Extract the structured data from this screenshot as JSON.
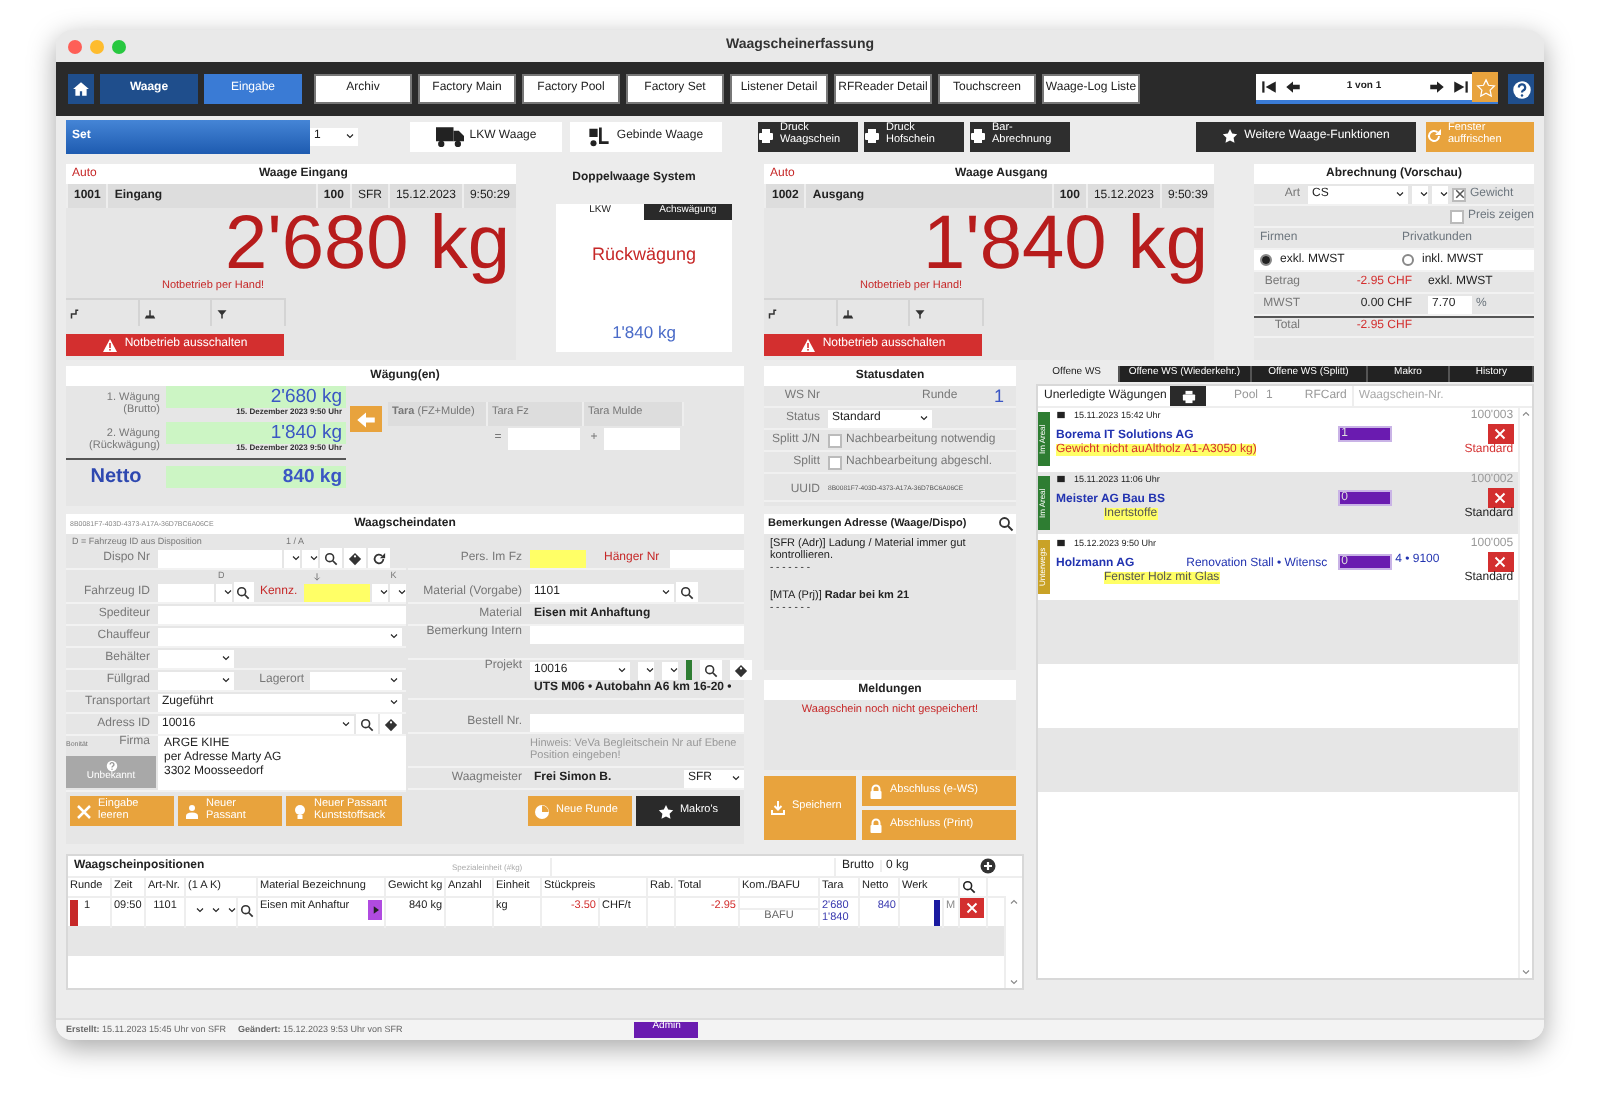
{
  "window": {
    "title": "Waagscheinerfassung"
  },
  "nav_tabs": [
    {
      "label": "Waage",
      "kind": "mode",
      "selected": true
    },
    {
      "label": "Eingabe",
      "kind": "mode",
      "selected": false
    },
    {
      "label": "Archiv",
      "kind": "tab",
      "selected": false
    },
    {
      "label": "Factory Main",
      "kind": "tab",
      "selected": false
    },
    {
      "label": "Factory Pool",
      "kind": "tab",
      "selected": false
    },
    {
      "label": "Factory Set",
      "kind": "tab",
      "selected": false
    },
    {
      "label": "Listener Detail",
      "kind": "tab",
      "selected": false
    },
    {
      "label": "RFReader Detail",
      "kind": "tab",
      "selected": false
    },
    {
      "label": "Touchscreen",
      "kind": "tab",
      "selected": false
    },
    {
      "label": "Waage-Log Liste",
      "kind": "tab",
      "selected": false
    }
  ],
  "pager": {
    "text": "1 von 1",
    "favorite": false
  },
  "toolbar": {
    "set_label": "Set",
    "set_value": "1",
    "scale_buttons": [
      {
        "label": "LKW Waage",
        "kind": "truck"
      },
      {
        "label": "Gebinde Waage",
        "kind": "forklift"
      }
    ],
    "print_buttons": [
      {
        "label": "Druck Waagschein",
        "kind": "print"
      },
      {
        "label": "Druck Hofschein",
        "kind": "print"
      },
      {
        "label": "Bar-Abrechnung",
        "kind": "print"
      }
    ],
    "function_buttons": [
      {
        "label": "Weitere Waage-Funktionen",
        "kind": "star"
      },
      {
        "label": "Fenster auffrischen",
        "kind": "refresh"
      }
    ]
  },
  "scales": [
    {
      "mode": "Auto",
      "title": "Waage Eingang",
      "number": "1001",
      "name": "Eingang",
      "code": "100",
      "user": "SFR",
      "date": "15.12.2023",
      "time": "9:50:29",
      "weight": "2'680 kg",
      "note": "Notbetrieb per Hand!",
      "action": "Notbetrieb ausschalten"
    },
    {
      "mode": "Auto",
      "title": "Waage Ausgang",
      "number": "1002",
      "name": "Ausgang",
      "code": "100",
      "date": "15.12.2023",
      "time": "9:50:39",
      "weight": "1'840 kg",
      "note": "Notbetrieb per Hand!",
      "action": "Notbetrieb ausschalten"
    }
  ],
  "double_scale": {
    "title": "Doppelwaage System",
    "tabs": [
      {
        "label": "LKW",
        "selected": true
      },
      {
        "label": "Achswägung",
        "selected": false
      }
    ],
    "status": "Rückwägung",
    "weight": "1'840 kg"
  },
  "billing": {
    "title": "Abrechnung (Vorschau)",
    "type_label": "Art",
    "type": "CS",
    "options": [
      {
        "label": "Gewicht",
        "checked": true
      },
      {
        "label": "Preis zeigen",
        "checked": false
      }
    ],
    "customer_tabs": [
      "Firmen",
      "Privatkunden"
    ],
    "vat": [
      {
        "label": "exkl. MWST",
        "selected": true
      },
      {
        "label": "inkl. MWST",
        "selected": false
      }
    ],
    "rows": [
      {
        "label": "Betrag",
        "value": "-2.95 CHF",
        "negative": true,
        "extra": "exkl. MWST"
      },
      {
        "label": "MWST",
        "value": "0.00 CHF",
        "negative": false,
        "rate": "7.70",
        "unit": "%"
      },
      {
        "label": "Total",
        "value": "-2.95 CHF",
        "negative": true
      }
    ]
  },
  "weighings": {
    "title": "Wägung(en)",
    "rows": [
      {
        "label": "1. Wägung",
        "sub": "(Brutto)",
        "value": "2'680 kg",
        "date": "15. Dezember 2023 9:50 Uhr"
      },
      {
        "label": "2. Wägung",
        "sub": "(Rückwägung)",
        "value": "1'840 kg",
        "date": "15. Dezember 2023 9:50 Uhr"
      }
    ],
    "net": {
      "label": "Netto",
      "value": "840 kg"
    },
    "tara_headers": [
      "**Tara** (FZ+Mulde)",
      "Tara Fz",
      "Tara Mulde"
    ],
    "operators": [
      "=",
      "+"
    ]
  },
  "status": {
    "title": "Statusdaten",
    "ws_label": "WS Nr",
    "round_label": "Runde",
    "round": "1",
    "status_label": "Status",
    "status": "Standard",
    "checks": [
      {
        "label": "Splitt J/N",
        "text": "Nachbearbeitung notwendig",
        "checked": false
      },
      {
        "label": "Splitt",
        "text": "Nachbearbeitung abgeschl.",
        "checked": false
      }
    ],
    "uuid_label": "UUID",
    "uuid": "8B0081F7-403D-4373-A17A-36D7BC6A06CE"
  },
  "ticket": {
    "uuid": "8B0081F7-403D-4373-A17A-36D7BC6A06CE",
    "title": "Waagscheindaten",
    "hint": "D = Fahrzeug ID aus Disposition",
    "marks": [
      "1 / A",
      "D",
      "K"
    ],
    "left_rows": [
      {
        "kind": "dispo",
        "label": "Dispo Nr"
      },
      {
        "kind": "vehicle",
        "label": "Fahrzeug ID",
        "label2": "Kennz."
      },
      {
        "kind": "text",
        "label": "Spediteur"
      },
      {
        "kind": "select",
        "label": "Chauffeur"
      },
      {
        "kind": "short",
        "label": "Behälter"
      },
      {
        "kind": "pair",
        "label": "Füllgrad",
        "label2": "Lagerort"
      },
      {
        "kind": "select",
        "label": "Transportart",
        "value": "Zugeführt"
      },
      {
        "kind": "lookup",
        "label": "Adress ID",
        "value": "10016"
      },
      {
        "kind": "address",
        "label": "Firma",
        "rating_label": "Bonität",
        "rating": "Unbekannt",
        "lines": [
          "ARGE KIHE",
          "per Adresse Marty AG",
          "3302 Moosseedorf"
        ]
      }
    ],
    "right_rows": [
      {
        "kind": "person",
        "label": "Pers. Im Fz",
        "label2": "Hänger Nr"
      },
      {
        "kind": "lookup_select",
        "label": "Material (Vorgabe)",
        "value": "1101"
      },
      {
        "kind": "static",
        "label": "Material",
        "value": "Eisen mit Anhaftung"
      },
      {
        "kind": "area",
        "label": "Bemerkung Intern"
      },
      {
        "kind": "project",
        "label": "Projekt",
        "value": "10016",
        "detail": "UTS M06 • Autobahn A6 km 16-20 •"
      },
      {
        "kind": "text",
        "label": "Bestell Nr."
      },
      {
        "kind": "hint",
        "value": "Hinweis: VeVa Begleitschein Nr auf Ebene Position eingeben!"
      },
      {
        "kind": "operator",
        "label": "Waagmeister",
        "value": "Frei Simon B.",
        "user": "SFR"
      }
    ],
    "buttons": [
      {
        "label": "Eingabe leeren",
        "kind": "clear"
      },
      {
        "label": "Neuer Passant",
        "kind": "person"
      },
      {
        "label": "Neuer Passant Kunststoffsack",
        "kind": "sack"
      },
      {
        "label": "Neue Runde",
        "kind": "round"
      },
      {
        "label": "Makro's",
        "kind": "macro"
      }
    ]
  },
  "remarks": {
    "title": "Bemerkungen Adresse (Waage/Dispo)",
    "entries": [
      {
        "text": "[SFR (Adr)] Ladung / Material immer gut kontrollieren.",
        "separator": "- - - - - - -"
      },
      {
        "text": "[MTA (Prj)] **Radar bei km 21**",
        "separator": "- - - - - - -"
      }
    ]
  },
  "messages": {
    "title": "Meldungen",
    "items": [
      "Waagschein noch nicht gespeichert!"
    ]
  },
  "save_buttons": [
    {
      "label": "Speichern",
      "kind": "save"
    },
    {
      "label": "Abschluss (e-WS)",
      "kind": "lock"
    },
    {
      "label": "Abschluss (Print)",
      "kind": "lock"
    }
  ],
  "open_tickets": {
    "tabs": [
      {
        "label": "Offene WS",
        "selected": true
      },
      {
        "label": "Offene WS (Wiederkehr.)",
        "selected": false
      },
      {
        "label": "Offene WS (Splitt)",
        "selected": false
      },
      {
        "label": "Makro",
        "selected": false
      },
      {
        "label": "History",
        "selected": false
      }
    ],
    "title": "Unerledigte Wägungen",
    "pool_label": "Pool",
    "pool": "1",
    "rfcard_label": "RFCard",
    "search_placeholder": "Waagschein-Nr.",
    "items": [
      {
        "state": "Im Areal",
        "color": "#2e7d32",
        "datetime": "15.11.2023 15:42 Uhr",
        "number": "100'003",
        "company": "Borema IT Solutions AG",
        "rfcard": "1",
        "material": "Gewicht nicht auAltholz A1-A3050 kg)",
        "warning": true,
        "status": "Standard"
      },
      {
        "state": "Im Areal",
        "color": "#2e7d32",
        "datetime": "15.11.2023 11:06 Uhr",
        "number": "100'002",
        "company": "Meister AG Bau BS",
        "rfcard": "0",
        "material": "Inertstoffe",
        "warning": false,
        "status": "Standard"
      },
      {
        "state": "Unterwegs",
        "color": "#c9a227",
        "datetime": "15.12.2023 9:50 Uhr",
        "number": "100'005",
        "company": "Holzmann AG",
        "project": "Renovation Stall • Witensc",
        "project_tail": "4 • 9100",
        "rfcard": "0",
        "material": "Fenster Holz mit Glas",
        "warning": false,
        "status": "Standard"
      }
    ]
  },
  "positions": {
    "title": "Waagscheinpositionen",
    "unit_placeholder": "Spezialeinheit (#kg)",
    "brutto_label": "Brutto",
    "brutto": "0 kg",
    "columns": [
      "Runde",
      "Zeit",
      "Art-Nr.",
      "(1  A  K)",
      "Material Bezeichnung",
      "Gewicht kg",
      "Anzahl",
      "Einheit",
      "Stückpreis",
      "Rab.",
      "Total",
      "Kom./BAFU",
      "Tara",
      "Netto",
      "Werk"
    ],
    "rows": [
      {
        "color": "#c62828",
        "round": "1",
        "time": "09:50",
        "article": "1101",
        "material": "Eisen mit Anhaftur",
        "weight": "840 kg",
        "unit": "kg",
        "price": "-3.50",
        "currency": "CHF/t",
        "total": "-2.95",
        "bafu": "BAFU",
        "tara": [
          "2'680",
          "1'840"
        ],
        "net": "840",
        "plant": "M"
      }
    ]
  },
  "footer": {
    "created": "**Erstellt:** 15.11.2023 15:45 Uhr von SFR",
    "changed": "**Geändert:** 15.12.2023 9:53 Uhr von SFR",
    "role": "Admin"
  }
}
